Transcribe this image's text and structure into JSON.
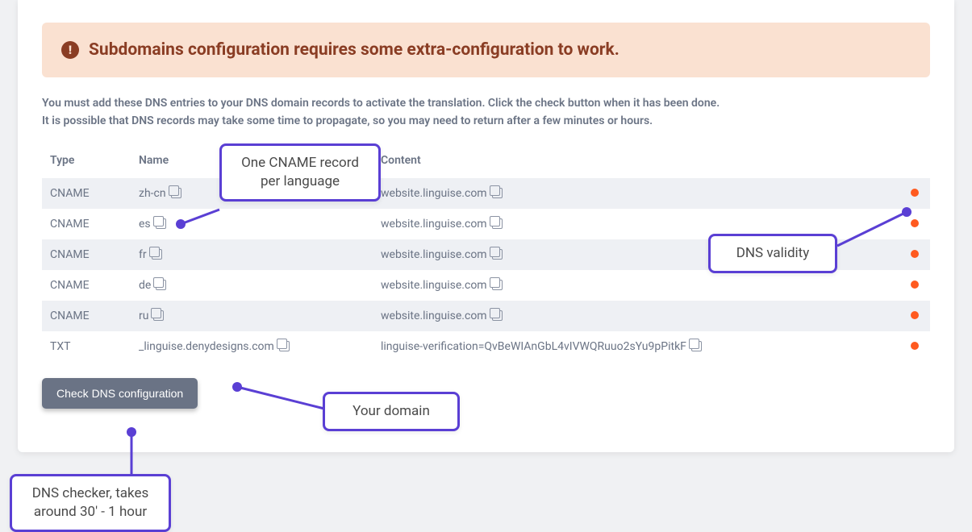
{
  "alert": {
    "text": "Subdomains configuration requires some extra-configuration to work."
  },
  "description": {
    "line1": "You must add these DNS entries to your DNS domain records to activate the translation. Click the check button when it has been done.",
    "line2": "It is possible that DNS records may take some time to propagate, so you may need to return after a few minutes or hours."
  },
  "table": {
    "headers": {
      "type": "Type",
      "name": "Name",
      "content": "Content"
    },
    "rows": [
      {
        "type": "CNAME",
        "name": "zh-cn",
        "content": "website.linguise.com"
      },
      {
        "type": "CNAME",
        "name": "es",
        "content": "website.linguise.com"
      },
      {
        "type": "CNAME",
        "name": "fr",
        "content": "website.linguise.com"
      },
      {
        "type": "CNAME",
        "name": "de",
        "content": "website.linguise.com"
      },
      {
        "type": "CNAME",
        "name": "ru",
        "content": "website.linguise.com"
      },
      {
        "type": "TXT",
        "name": "_linguise.denydesigns.com",
        "content": "linguise-verification=QvBeWIAnGbL4vIVWQRuuo2sYu9pPitkF"
      }
    ]
  },
  "button": {
    "label": "Check DNS configuration"
  },
  "callouts": {
    "cname": "One CNAME record per language",
    "validity": "DNS validity",
    "domain": "Your domain",
    "checker": "DNS checker, takes around 30' - 1 hour"
  },
  "colors": {
    "accent": "#5a3fd4",
    "status_pending": "#ff5a1f",
    "alert_bg": "#fae1d1",
    "alert_fg": "#8a3d24"
  }
}
